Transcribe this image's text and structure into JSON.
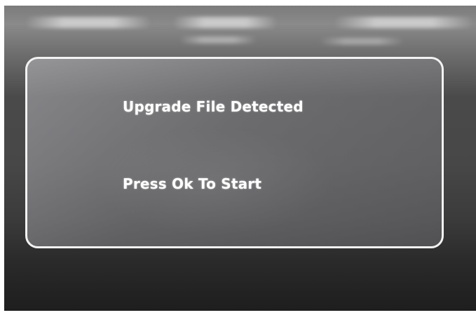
{
  "dialog": {
    "message_line1": "Upgrade File Detected",
    "message_line2": "Press Ok To Start"
  },
  "colors": {
    "text": "#ffffff",
    "border": "#f2f2f2",
    "screen_background": "#474747"
  }
}
